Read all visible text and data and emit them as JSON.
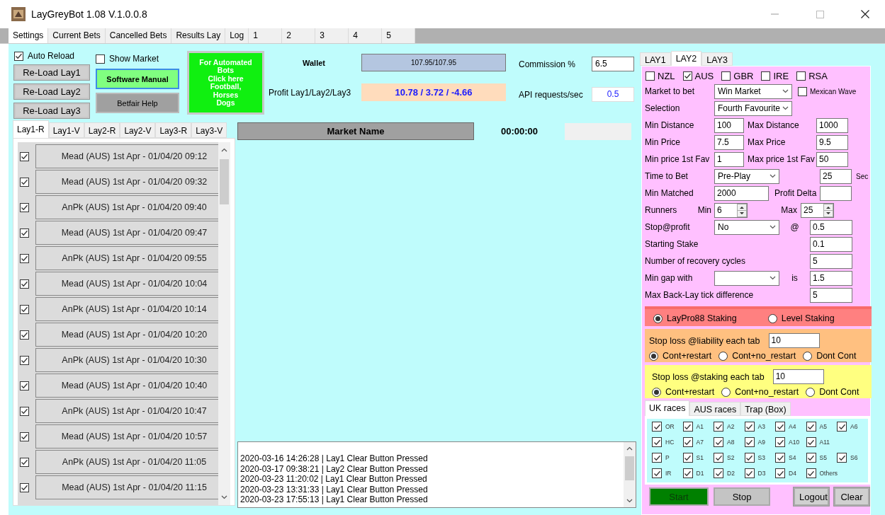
{
  "window": {
    "title": "LayGreyBot 1.08 V.1.0.0.8"
  },
  "tabs": [
    {
      "label": "Settings",
      "selected": true
    },
    {
      "label": "Current Bets",
      "selected": false
    },
    {
      "label": "Cancelled Bets",
      "selected": false
    },
    {
      "label": "Results Lay",
      "selected": false
    },
    {
      "label": "Log",
      "selected": false
    },
    {
      "label": "1",
      "selected": false
    },
    {
      "label": "2",
      "selected": false
    },
    {
      "label": "3",
      "selected": false
    },
    {
      "label": "4",
      "selected": false
    },
    {
      "label": "5",
      "selected": false
    }
  ],
  "controls": {
    "auto_reload": {
      "label": "Auto Reload",
      "checked": true
    },
    "reload_buttons": [
      "Re-Load Lay1",
      "Re-Load Lay2",
      "Re-Load Lay3"
    ],
    "show_market": {
      "label": "Show Market",
      "checked": false
    },
    "manual_button": "Software Manual",
    "help_button": "Betfair Help",
    "promo_button": [
      "For Automated",
      "Bots",
      "Click here",
      "Football,",
      "Horses",
      "Dogs"
    ],
    "wallet": {
      "label": "Wallet",
      "value": "107.95/107.95"
    },
    "profit": {
      "label": "Profit Lay1/Lay2/Lay3",
      "value": "10.78 / 3.72 / -4.66"
    },
    "commission": {
      "label": "Commission %",
      "value": "6.5"
    },
    "api_rate": {
      "label": "API requests/sec",
      "value": "0.5"
    }
  },
  "race_tabs": [
    {
      "label": "Lay1-R",
      "selected": true
    },
    {
      "label": "Lay1-V",
      "selected": false
    },
    {
      "label": "Lay2-R",
      "selected": false
    },
    {
      "label": "Lay2-V",
      "selected": false
    },
    {
      "label": "Lay3-R",
      "selected": false
    },
    {
      "label": "Lay3-V",
      "selected": false
    }
  ],
  "races": [
    {
      "name": "Mead (AUS) 1st Apr - 01/04/20 09:12",
      "checked": true
    },
    {
      "name": "Mead (AUS) 1st Apr - 01/04/20 09:32",
      "checked": true
    },
    {
      "name": "AnPk (AUS) 1st Apr - 01/04/20 09:40",
      "checked": true
    },
    {
      "name": "Mead (AUS) 1st Apr - 01/04/20 09:47",
      "checked": true
    },
    {
      "name": "AnPk (AUS) 1st Apr - 01/04/20 09:55",
      "checked": true
    },
    {
      "name": "Mead (AUS) 1st Apr - 01/04/20 10:04",
      "checked": true
    },
    {
      "name": "AnPk (AUS) 1st Apr - 01/04/20 10:14",
      "checked": true
    },
    {
      "name": "Mead (AUS) 1st Apr - 01/04/20 10:20",
      "checked": true
    },
    {
      "name": "AnPk (AUS) 1st Apr - 01/04/20 10:30",
      "checked": true
    },
    {
      "name": "Mead (AUS) 1st Apr - 01/04/20 10:40",
      "checked": true
    },
    {
      "name": "AnPk (AUS) 1st Apr - 01/04/20 10:47",
      "checked": true
    },
    {
      "name": "Mead (AUS) 1st Apr - 01/04/20 10:57",
      "checked": true
    },
    {
      "name": "AnPk (AUS) 1st Apr - 01/04/20 11:05",
      "checked": true
    },
    {
      "name": "Mead (AUS) 1st Apr - 01/04/20 11:15",
      "checked": true
    }
  ],
  "market": {
    "header": "Market Name",
    "timer": "00:00:00"
  },
  "log": [
    "2020-03-16 14:26:28 | Lay1 Clear Button Pressed",
    "2020-03-17 09:38:21 | Lay2 Clear Button Pressed",
    "2020-03-23 11:20:02 | Lay1 Clear Button Pressed",
    "2020-03-23 13:31:33 | Lay1 Clear Button Pressed",
    "2020-03-23 17:55:13 | Lay1 Clear Button Pressed"
  ],
  "lay_panel": {
    "tabs": [
      {
        "label": "LAY1",
        "selected": false
      },
      {
        "label": "LAY2",
        "selected": true
      },
      {
        "label": "LAY3",
        "selected": false
      }
    ],
    "countries": [
      {
        "label": "NZL",
        "checked": false
      },
      {
        "label": "AUS",
        "checked": true
      },
      {
        "label": "GBR",
        "checked": false
      },
      {
        "label": "IRE",
        "checked": false
      },
      {
        "label": "RSA",
        "checked": false
      }
    ],
    "rows": [
      {
        "kind": "select",
        "label": "Market to bet",
        "value": "Win Market",
        "check": {
          "label": "Mexican Wave",
          "checked": false
        }
      },
      {
        "kind": "select",
        "label": "Selection",
        "value": "Fourth Favourite"
      },
      {
        "kind": "pair",
        "label": "Min Distance",
        "value": "100",
        "label2": "Max Distance",
        "value2": "1000"
      },
      {
        "kind": "pair",
        "label": "Min Price",
        "value": "7.5",
        "label2": "Max Price",
        "value2": "9.5"
      },
      {
        "kind": "pair",
        "label": "Min price 1st Fav",
        "value": "1",
        "label2": "Max price 1st Fav",
        "value2": "50"
      },
      {
        "kind": "select_unit",
        "label": "Time to Bet",
        "value": "Pre-Play",
        "value2": "25",
        "unit": "Sec"
      },
      {
        "kind": "wide_pair",
        "label": "Min Matched",
        "value": "2000",
        "label2": "Profit Delta"
      },
      {
        "kind": "spin",
        "label": "Runners",
        "min_label": "Min",
        "min": "6",
        "max_label": "Max",
        "max": "25"
      },
      {
        "kind": "select_at",
        "label": "Stop@profit",
        "value": "No",
        "sep": "@",
        "value2": "0.5"
      },
      {
        "kind": "single",
        "label": "Starting Stake",
        "value": "0.1"
      },
      {
        "kind": "single",
        "label": "Number of recovery cycles",
        "value": "5"
      },
      {
        "kind": "select_at",
        "label": "Min gap with",
        "sep": "is",
        "value2": "1.5"
      },
      {
        "kind": "single",
        "label": "Max Back-Lay tick difference",
        "value": "5"
      }
    ],
    "staking": [
      {
        "label": "LayPro88 Staking",
        "selected": true
      },
      {
        "label": "Level Staking",
        "selected": false
      }
    ],
    "liability": {
      "label": "Stop loss @liability each tab",
      "value": "10",
      "options": [
        {
          "label": "Cont+restart",
          "selected": true
        },
        {
          "label": "Cont+no_restart",
          "selected": false
        },
        {
          "label": "Dont Cont",
          "selected": false
        }
      ]
    },
    "staking_stop": {
      "label": "Stop loss @staking each tab",
      "value": "10",
      "options": [
        {
          "label": "Cont+restart",
          "selected": true
        },
        {
          "label": "Cont+no_restart",
          "selected": false
        },
        {
          "label": "Dont Cont",
          "selected": false
        }
      ]
    },
    "race_type_tabs": [
      {
        "label": "UK races",
        "selected": true
      },
      {
        "label": "AUS races",
        "selected": false
      },
      {
        "label": "Trap (Box)",
        "selected": false
      }
    ],
    "race_type_rows": [
      [
        {
          "label": "OR",
          "checked": true
        },
        {
          "label": "A1",
          "checked": true
        },
        {
          "label": "A2",
          "checked": true
        },
        {
          "label": "A3",
          "checked": true
        },
        {
          "label": "A4",
          "checked": true
        },
        {
          "label": "A5",
          "checked": true
        },
        {
          "label": "A6",
          "checked": true
        }
      ],
      [
        {
          "label": "HC",
          "checked": true
        },
        {
          "label": "A7",
          "checked": true
        },
        {
          "label": "A8",
          "checked": true
        },
        {
          "label": "A9",
          "checked": true
        },
        {
          "label": "A10",
          "checked": true
        },
        {
          "label": "A11",
          "checked": true
        }
      ],
      [
        {
          "label": "P",
          "checked": true
        },
        {
          "label": "S1",
          "checked": true
        },
        {
          "label": "S2",
          "checked": true
        },
        {
          "label": "S3",
          "checked": true
        },
        {
          "label": "S4",
          "checked": true
        },
        {
          "label": "S5",
          "checked": true
        },
        {
          "label": "S6",
          "checked": true
        }
      ],
      [
        {
          "label": "IR",
          "checked": true
        },
        {
          "label": "D1",
          "checked": true
        },
        {
          "label": "D2",
          "checked": true
        },
        {
          "label": "D3",
          "checked": true
        },
        {
          "label": "D4",
          "checked": true
        },
        {
          "label": "Others",
          "checked": true
        }
      ]
    ],
    "buttons": [
      {
        "label": "Start",
        "kind": "start"
      },
      {
        "label": "Stop",
        "kind": "stop"
      },
      {
        "label": "Logout",
        "kind": "plain"
      },
      {
        "label": "Clear",
        "kind": "plain"
      }
    ]
  }
}
